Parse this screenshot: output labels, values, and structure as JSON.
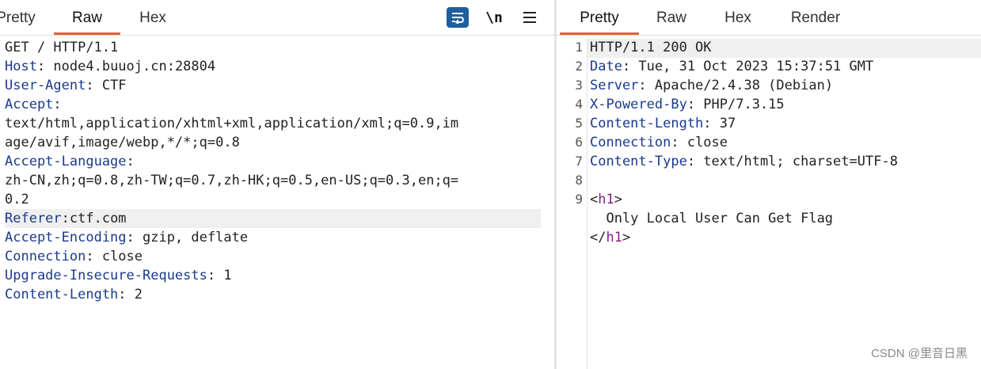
{
  "request": {
    "tabs": [
      "Pretty",
      "Raw",
      "Hex"
    ],
    "active_tab": "Raw",
    "toolbar": {
      "wrap_icon": "wrap-lines-icon",
      "newline_label": "\\n",
      "menu_icon": "hamburger-menu-icon"
    },
    "lines": [
      {
        "key": "",
        "value": "GET / HTTP/1.1"
      },
      {
        "key": "Host",
        "value": ": node4.buuoj.cn:28804"
      },
      {
        "key": "User-Agent",
        "value": ": CTF"
      },
      {
        "key": "Accept",
        "value": ":"
      },
      {
        "key": "",
        "value": "text/html,application/xhtml+xml,application/xml;q=0.9,im"
      },
      {
        "key": "",
        "value": "age/avif,image/webp,*/*;q=0.8"
      },
      {
        "key": "Accept-Language",
        "value": ":"
      },
      {
        "key": "",
        "value": "zh-CN,zh;q=0.8,zh-TW;q=0.7,zh-HK;q=0.5,en-US;q=0.3,en;q="
      },
      {
        "key": "",
        "value": "0.2"
      },
      {
        "key": "Referer",
        "value": ":ctf.com"
      },
      {
        "key": "Accept-Encoding",
        "value": ": gzip, deflate"
      },
      {
        "key": "Connection",
        "value": ": close"
      },
      {
        "key": "Upgrade-Insecure-Requests",
        "value": ": 1"
      },
      {
        "key": "Content-Length",
        "value": ": 2"
      }
    ]
  },
  "response": {
    "tabs": [
      "Pretty",
      "Raw",
      "Hex",
      "Render"
    ],
    "active_tab": "Pretty",
    "line_numbers": [
      "1",
      "2",
      "3",
      "4",
      "5",
      "6",
      "7",
      "8",
      "9"
    ],
    "lines": [
      {
        "key": "",
        "value": "HTTP/1.1 200 OK"
      },
      {
        "key": "Date",
        "value": ": Tue, 31 Oct 2023 15:37:51 GMT"
      },
      {
        "key": "Server",
        "value": ": Apache/2.4.38 (Debian)"
      },
      {
        "key": "X-Powered-By",
        "value": ": PHP/7.3.15"
      },
      {
        "key": "Content-Length",
        "value": ": 37"
      },
      {
        "key": "Connection",
        "value": ": close"
      },
      {
        "key": "Content-Type",
        "value": ": text/html; charset=UTF-8"
      },
      {
        "key": "",
        "value": ""
      }
    ],
    "body": {
      "open_tag_bracket": "<",
      "tag_name": "h1",
      "close_bracket": ">",
      "text": "  Only Local User Can Get Flag",
      "end_tag_bracket": "</"
    }
  },
  "watermark": "CSDN @里音日黑",
  "colors": {
    "accent": "#e8603c",
    "header_key": "#1a3a8c",
    "tag": "#8a1d8a",
    "wrap_button": "#1e5f9e"
  }
}
